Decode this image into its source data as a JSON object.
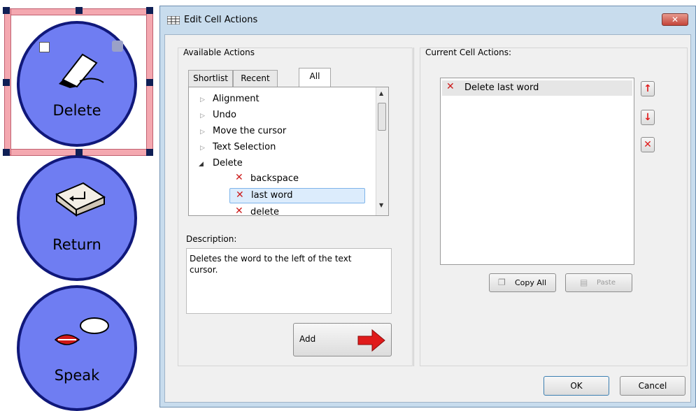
{
  "cells": [
    {
      "label": "Delete"
    },
    {
      "label": "Return"
    },
    {
      "label": "Speak"
    }
  ],
  "dialog": {
    "title": "Edit Cell Actions",
    "available_actions_label": "Available Actions",
    "tabs": [
      "Shortlist",
      "Recent",
      "All"
    ],
    "active_tab": "All",
    "tree": {
      "groups": [
        "Alignment",
        "Undo",
        "Move the cursor",
        "Text Selection",
        "Delete"
      ],
      "children": [
        "backspace",
        "last word",
        "delete"
      ],
      "selected": "last word"
    },
    "description_label": "Description:",
    "description_text": "Deletes the word to the left of the text cursor.",
    "add_label": "Add",
    "current_actions_label": "Current Cell Actions:",
    "current_actions": [
      "Delete last word"
    ],
    "copy_all_label": "Copy All",
    "paste_label": "Paste",
    "ok_label": "OK",
    "cancel_label": "Cancel"
  },
  "colors": {
    "cell_fill": "#6f7df2",
    "cell_border": "#10187a",
    "selection": "#f4a8b0",
    "dialog_frame": "#c8dced",
    "delete_x": "#cc1b1b",
    "arrow_red": "#e01b1b"
  },
  "icons": [
    "eraser-icon",
    "enter-key-icon",
    "speech-lips-icon",
    "grid-app-icon",
    "close-icon",
    "move-up-icon",
    "move-down-icon",
    "remove-icon",
    "red-x-icon",
    "copy-icon",
    "paste-icon",
    "red-arrow-icon"
  ]
}
